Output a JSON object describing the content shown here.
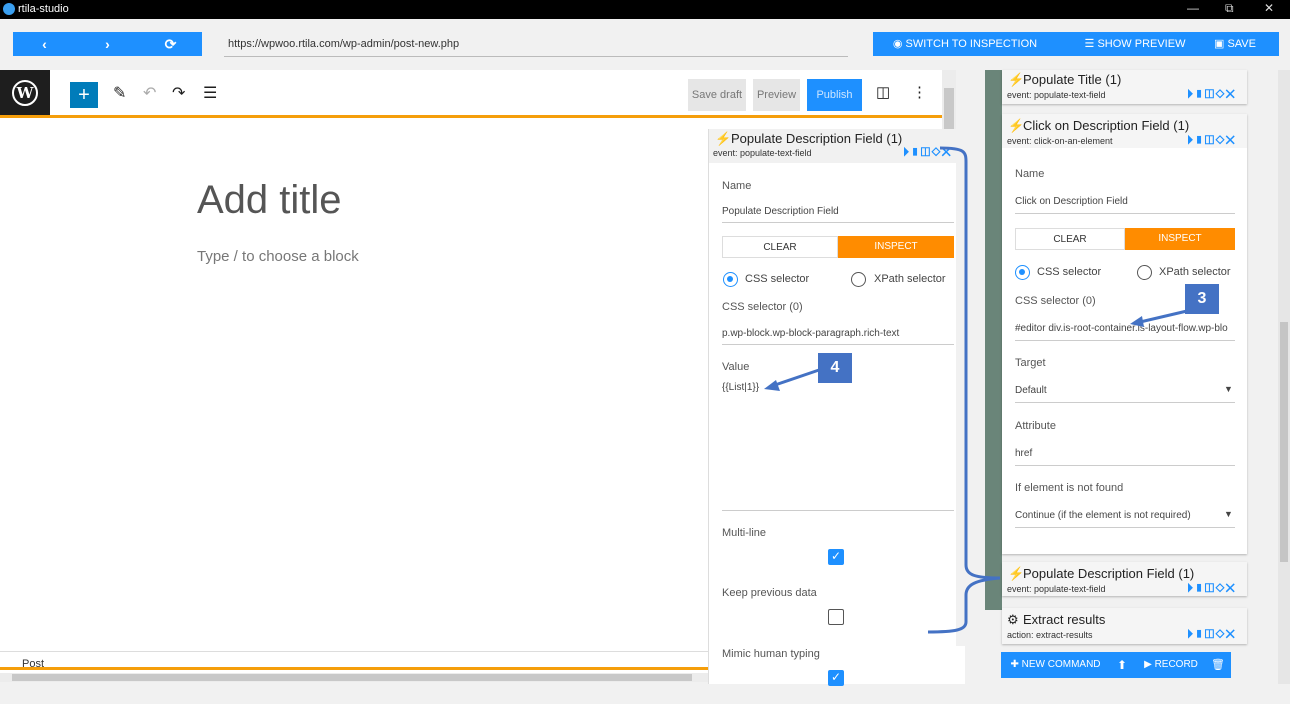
{
  "window": {
    "title": "rtila-studio",
    "controls": [
      "—",
      "⧉",
      "✕"
    ]
  },
  "toolbar": {
    "back": "‹",
    "forward": "›",
    "reload": "⟳",
    "url": "https://wpwoo.rtila.com/wp-admin/post-new.php",
    "switch_inspection": "SWITCH TO INSPECTION",
    "show_preview": "SHOW PREVIEW",
    "save": "SAVE"
  },
  "wp": {
    "logo": "W",
    "add": "+",
    "save_draft": "Save draft",
    "preview": "Preview",
    "publish": "Publish",
    "title_placeholder": "Add title",
    "block_placeholder": "Type / to choose a block",
    "footer": "Post"
  },
  "mid": {
    "title": "Populate Description Field (1)",
    "event": "event:  populate-text-field",
    "icons": "⏵▮◫◇✕",
    "name_label": "Name",
    "name_value": "Populate Description Field",
    "clear": "CLEAR",
    "inspect": "INSPECT",
    "css_radio": "CSS selector",
    "xpath_radio": "XPath selector",
    "selector_label": "CSS selector (0)",
    "selector_value": "p.wp-block.wp-block-paragraph.rich-text",
    "value_label": "Value",
    "value": "{{List|1}}",
    "multiline": "Multi-line",
    "multiline_checked": true,
    "keep_prev": "Keep previous data",
    "keep_prev_checked": false,
    "mimic": "Mimic human typing",
    "mimic_checked": true
  },
  "right": {
    "cards": [
      {
        "title": "Populate Title (1)",
        "sub": "event:  populate-text-field",
        "prefix": "⚡"
      },
      {
        "title": "Click on Description Field (1)",
        "sub": "event:  click-on-an-element",
        "prefix": "⚡"
      },
      {
        "title": "Populate Description Field (1)",
        "sub": "event:  populate-text-field",
        "prefix": "⚡"
      },
      {
        "title": "Extract results",
        "sub": "action:  extract-results",
        "prefix": "⚙"
      }
    ],
    "icons": "⏵▮◫◇✕",
    "name_label": "Name",
    "name_value": "Click on Description Field",
    "clear": "CLEAR",
    "inspect": "INSPECT",
    "css_radio": "CSS selector",
    "xpath_radio": "XPath selector",
    "selector_label": "CSS selector (0)",
    "selector_value": "#editor div.is-root-container.is-layout-flow.wp-blo",
    "target_label": "Target",
    "target_value": "Default",
    "attribute_label": "Attribute",
    "attribute_value": "href",
    "notfound_label": "If element is not found",
    "notfound_value": "Continue (if the element is not required)"
  },
  "bottom": {
    "new_command": "NEW COMMAND",
    "upload": "⬆",
    "record": "RECORD",
    "trash": "🗑"
  },
  "callouts": {
    "three": "3",
    "four": "4"
  }
}
